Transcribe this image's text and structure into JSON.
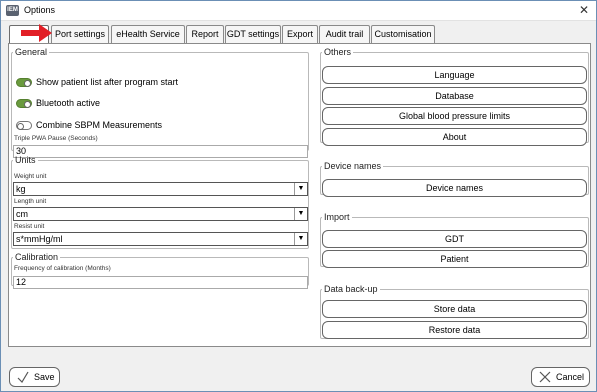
{
  "window": {
    "title": "Options",
    "app_icon_text": "IEM"
  },
  "tabs": [
    {
      "label": ""
    },
    {
      "label": "Port settings"
    },
    {
      "label": "eHealth Service"
    },
    {
      "label": "Report"
    },
    {
      "label": "GDT settings"
    },
    {
      "label": "Export"
    },
    {
      "label": "Audit trail"
    },
    {
      "label": "Customisation"
    }
  ],
  "general": {
    "legend": "General",
    "toggles": [
      {
        "label": "Show patient list after program start",
        "state": "on"
      },
      {
        "label": "Bluetooth active",
        "state": "on"
      },
      {
        "label": "Combine SBPM Measurements",
        "state": "off"
      }
    ],
    "pause_label": "Triple PWA Pause (Seconds)",
    "pause_value": "30"
  },
  "units": {
    "legend": "Units",
    "weight_label": "Weight unit",
    "weight_value": "kg",
    "length_label": "Length unit",
    "length_value": "cm",
    "resist_label": "Resist unit",
    "resist_value": "s*mmHg/ml"
  },
  "calibration": {
    "legend": "Calibration",
    "freq_label": "Frequency of calibration (Months)",
    "freq_value": "12"
  },
  "others": {
    "legend": "Others",
    "buttons": [
      "Language",
      "Database",
      "Global blood pressure limits",
      "About"
    ]
  },
  "device_names": {
    "legend": "Device names",
    "button": "Device names"
  },
  "import": {
    "legend": "Import",
    "buttons": [
      "GDT",
      "Patient"
    ]
  },
  "backup": {
    "legend": "Data back-up",
    "buttons": [
      "Store data",
      "Restore data"
    ]
  },
  "footer": {
    "save": "Save",
    "cancel": "Cancel"
  },
  "colors": {
    "toggle_on": "#6a9a3e",
    "arrow": "#e21f26",
    "border": "#6b8fb5"
  },
  "icons": {
    "close": "close-icon",
    "app": "app-icon",
    "arrow": "red-arrow-icon",
    "save": "checkmark-icon",
    "cancel": "x-icon",
    "dropdown": "chevron-down-icon"
  }
}
